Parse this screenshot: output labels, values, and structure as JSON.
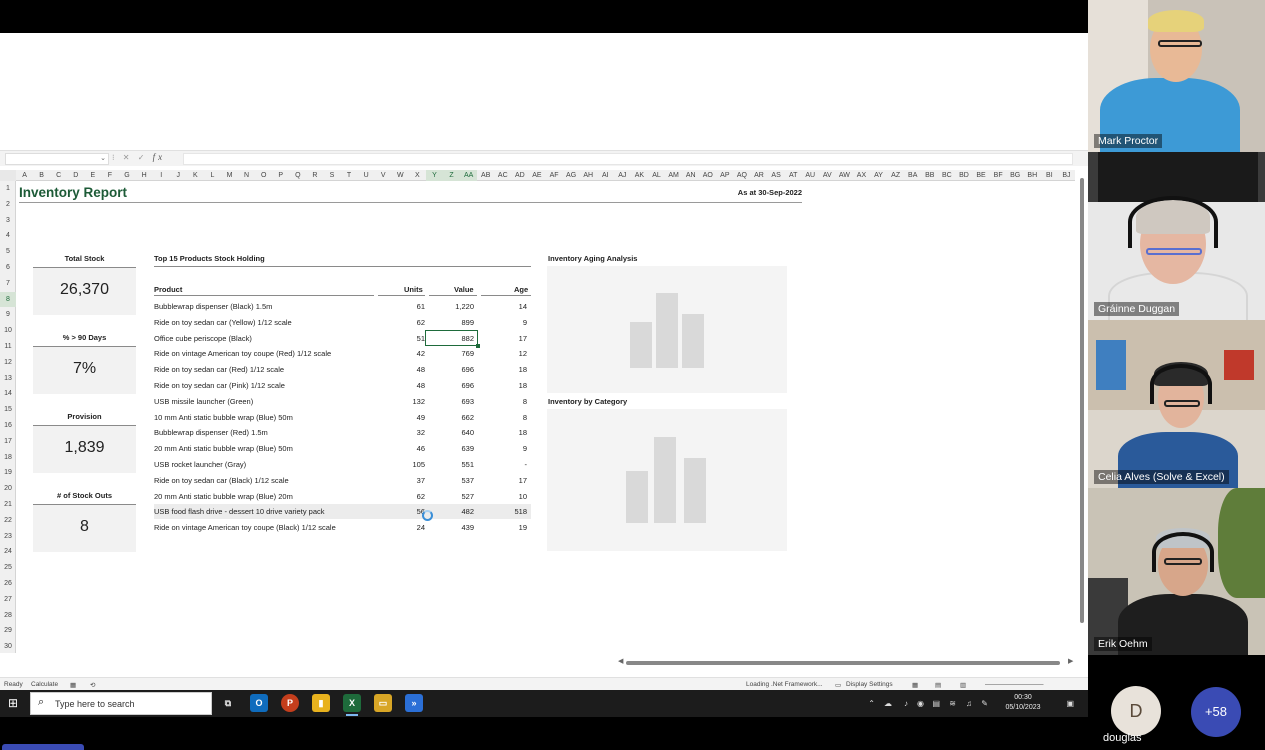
{
  "excel": {
    "name_box": "",
    "columns": [
      "A",
      "B",
      "C",
      "D",
      "E",
      "F",
      "G",
      "H",
      "I",
      "J",
      "K",
      "L",
      "M",
      "N",
      "O",
      "P",
      "Q",
      "R",
      "S",
      "T",
      "U",
      "V",
      "W",
      "X",
      "Y",
      "Z",
      "AA",
      "AB",
      "AC",
      "AD",
      "AE",
      "AF",
      "AG",
      "AH",
      "AI",
      "AJ",
      "AK",
      "AL",
      "AM",
      "AN",
      "AO",
      "AP",
      "AQ",
      "AR",
      "AS",
      "AT",
      "AU",
      "AV",
      "AW",
      "AX",
      "AY",
      "AZ",
      "BA",
      "BB",
      "BC",
      "BD",
      "BE",
      "BF",
      "BG",
      "BH",
      "BI",
      "BJ"
    ],
    "selected_columns": [
      "Y",
      "Z",
      "AA"
    ],
    "rows": [
      "1",
      "2",
      "3",
      "4",
      "5",
      "6",
      "7",
      "8",
      "9",
      "10",
      "11",
      "12",
      "13",
      "14",
      "15",
      "16",
      "17",
      "18",
      "19",
      "20",
      "21",
      "22",
      "23",
      "24",
      "25",
      "26",
      "27",
      "28",
      "29",
      "30"
    ],
    "selected_row": "8",
    "report": {
      "title": "Inventory Report",
      "as_at": "As at 30-Sep-2022",
      "kpis": [
        {
          "label": "Total Stock",
          "value": "26,370"
        },
        {
          "label": "% > 90 Days",
          "value": "7%"
        },
        {
          "label": "Provision",
          "value": "1,839"
        },
        {
          "label": "# of Stock Outs",
          "value": "8"
        }
      ],
      "table_title": "Top 15 Products Stock Holding",
      "table_headers": {
        "product": "Product",
        "units": "Units",
        "value": "Value",
        "age": "Age"
      },
      "table_rows": [
        {
          "product": "Bubblewrap dispenser (Black) 1.5m",
          "units": "61",
          "value": "1,220",
          "age": "14"
        },
        {
          "product": "Ride on toy sedan car (Yellow) 1/12 scale",
          "units": "62",
          "value": "899",
          "age": "9"
        },
        {
          "product": "Office cube periscope (Black)",
          "units": "51",
          "value": "882",
          "age": "17"
        },
        {
          "product": "Ride on vintage American toy coupe (Red) 1/12 scale",
          "units": "42",
          "value": "769",
          "age": "12"
        },
        {
          "product": "Ride on toy sedan car (Red) 1/12 scale",
          "units": "48",
          "value": "696",
          "age": "18"
        },
        {
          "product": "Ride on toy sedan car (Pink) 1/12 scale",
          "units": "48",
          "value": "696",
          "age": "18"
        },
        {
          "product": "USB missile launcher (Green)",
          "units": "132",
          "value": "693",
          "age": "8"
        },
        {
          "product": "10 mm Anti static bubble wrap (Blue) 50m",
          "units": "49",
          "value": "662",
          "age": "8"
        },
        {
          "product": "Bubblewrap dispenser (Red) 1.5m",
          "units": "32",
          "value": "640",
          "age": "18"
        },
        {
          "product": "20 mm Anti static bubble wrap (Blue) 50m",
          "units": "46",
          "value": "639",
          "age": "9"
        },
        {
          "product": "USB rocket launcher (Gray)",
          "units": "105",
          "value": "551",
          "age": "-"
        },
        {
          "product": "Ride on toy sedan car (Black) 1/12 scale",
          "units": "37",
          "value": "537",
          "age": "17"
        },
        {
          "product": "20 mm Anti static bubble wrap (Blue) 20m",
          "units": "62",
          "value": "527",
          "age": "10"
        },
        {
          "product": "USB food flash drive - dessert 10 drive variety pack",
          "units": "56",
          "value": "482",
          "age": "518"
        },
        {
          "product": "Ride on vintage American toy coupe (Black) 1/12 scale",
          "units": "24",
          "value": "439",
          "age": "19"
        }
      ],
      "charts": [
        {
          "title": "Inventory Aging Analysis"
        },
        {
          "title": "Inventory by Category"
        }
      ]
    },
    "status": {
      "ready": "Ready",
      "calculate": "Calculate",
      "loading": "Loading .Net Framework...",
      "display_settings": "Display Settings"
    }
  },
  "taskbar": {
    "search_placeholder": "Type here to search",
    "time": "00:30",
    "date": "05/10/2023"
  },
  "participants": [
    {
      "name": "Mark Proctor"
    },
    {
      "name": "Gráinne Duggan"
    },
    {
      "name": "Celia Alves (Solve & Excel)"
    },
    {
      "name": "Erik Oehm"
    }
  ],
  "overflow": {
    "avatar_initial": "D",
    "avatar_name": "douglas",
    "more": "+58"
  },
  "colors": {
    "excel_green": "#1e6b3b",
    "title_green": "#1d5b37",
    "teams_blue": "#3a4bb4"
  }
}
